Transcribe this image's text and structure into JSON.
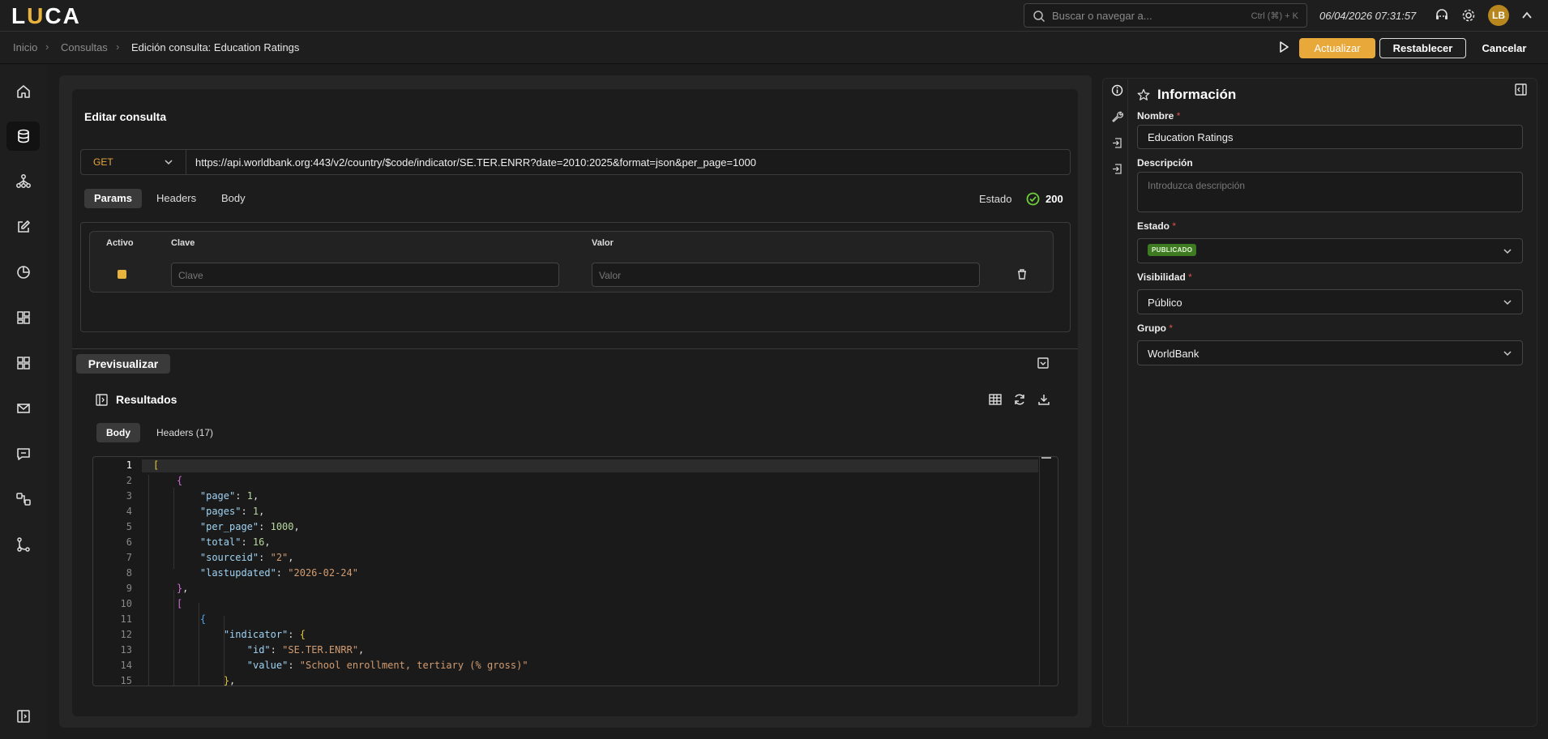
{
  "app": {
    "logo_prefix": "L",
    "logo_mid": "U",
    "logo_suffix": "CA"
  },
  "topbar": {
    "search_placeholder": "Buscar o navegar a...",
    "search_shortcut": "Ctrl (⌘) + K",
    "datetime": "06/04/2026 07:31:57",
    "avatar_initials": "LB"
  },
  "breadcrumb": {
    "items": [
      "Inicio",
      "Consultas"
    ],
    "current": "Edición consulta: Education Ratings"
  },
  "actions": {
    "update": "Actualizar",
    "reset": "Restablecer",
    "cancel": "Cancelar"
  },
  "editor": {
    "title": "Editar consulta",
    "method": "GET",
    "url": "https://api.worldbank.org:443/v2/country/$code/indicator/SE.TER.ENRR?date=2010:2025&format=json&per_page=1000",
    "tabs": [
      "Params",
      "Headers",
      "Body"
    ],
    "status_label": "Estado",
    "status_code": "200",
    "params": {
      "columns": [
        "Activo",
        "Clave",
        "Valor"
      ],
      "key_placeholder": "Clave",
      "value_placeholder": "Valor"
    }
  },
  "preview": {
    "label": "Previsualizar",
    "results_title": "Resultados",
    "tabs": [
      "Body",
      "Headers (17)"
    ]
  },
  "code_lines": [
    {
      "n": "1",
      "t": "["
    },
    {
      "n": "2",
      "t": "    {"
    },
    {
      "n": "3",
      "t": "        \"page\": 1,"
    },
    {
      "n": "4",
      "t": "        \"pages\": 1,"
    },
    {
      "n": "5",
      "t": "        \"per_page\": 1000,"
    },
    {
      "n": "6",
      "t": "        \"total\": 16,"
    },
    {
      "n": "7",
      "t": "        \"sourceid\": \"2\","
    },
    {
      "n": "8",
      "t": "        \"lastupdated\": \"2026-02-24\""
    },
    {
      "n": "9",
      "t": "    },"
    },
    {
      "n": "10",
      "t": "    ["
    },
    {
      "n": "11",
      "t": "        {"
    },
    {
      "n": "12",
      "t": "            \"indicator\": {"
    },
    {
      "n": "13",
      "t": "                \"id\": \"SE.TER.ENRR\","
    },
    {
      "n": "14",
      "t": "                \"value\": \"School enrollment, tertiary (% gross)\""
    },
    {
      "n": "15",
      "t": "            },"
    }
  ],
  "info": {
    "title": "Información",
    "name_label": "Nombre",
    "name_value": "Education Ratings",
    "desc_label": "Descripción",
    "desc_placeholder": "Introduzca descripción",
    "state_label": "Estado",
    "state_value": "PUBLICADO",
    "visibility_label": "Visibilidad",
    "visibility_value": "Público",
    "group_label": "Grupo",
    "group_value": "WorldBank",
    "required_mark": "*"
  },
  "colors": {
    "accent": "#e8a83a",
    "published": "#3d7a22",
    "status_ok": "#6fcf3a"
  }
}
